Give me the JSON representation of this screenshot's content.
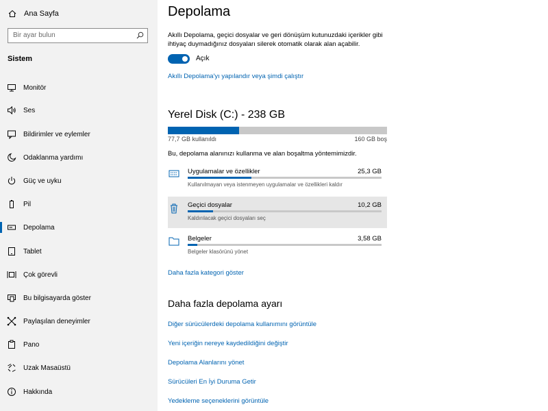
{
  "sidebar": {
    "home_label": "Ana Sayfa",
    "search_placeholder": "Bir ayar bulun",
    "section_label": "Sistem",
    "items": [
      {
        "label": "Monitör",
        "icon": "monitor-icon"
      },
      {
        "label": "Ses",
        "icon": "speaker-icon"
      },
      {
        "label": "Bildirimler ve eylemler",
        "icon": "notifications-icon"
      },
      {
        "label": "Odaklanma yardımı",
        "icon": "moon-icon"
      },
      {
        "label": "Güç ve uyku",
        "icon": "power-icon"
      },
      {
        "label": "Pil",
        "icon": "battery-icon"
      },
      {
        "label": "Depolama",
        "icon": "storage-icon",
        "active": true
      },
      {
        "label": "Tablet",
        "icon": "tablet-icon"
      },
      {
        "label": "Çok görevli",
        "icon": "multitasking-icon"
      },
      {
        "label": "Bu bilgisayarda göster",
        "icon": "project-icon"
      },
      {
        "label": "Paylaşılan deneyimler",
        "icon": "shared-experiences-icon"
      },
      {
        "label": "Pano",
        "icon": "clipboard-icon"
      },
      {
        "label": "Uzak Masaüstü",
        "icon": "remote-desktop-icon"
      },
      {
        "label": "Hakkında",
        "icon": "info-icon"
      }
    ]
  },
  "main": {
    "title": "Depolama",
    "description": "Akıllı Depolama, geçici dosyalar ve geri dönüşüm kutunuzdaki içerikler gibi ihtiyaç duymadığınız dosyaları silerek otomatik olarak alan açabilir.",
    "toggle_state": "Açık",
    "configure_link": "Akıllı Depolama'yı yapılandır veya şimdi çalıştır",
    "disk": {
      "title": "Yerel Disk (C:) - 238 GB",
      "used_label": "77,7 GB kullanıldı",
      "free_label": "160 GB boş",
      "used_fraction": 0.326
    },
    "usage_text": "Bu, depolama alanınızı kullanma ve alan boşaltma yöntemimizdir.",
    "categories": [
      {
        "name": "Uygulamalar ve özellikler",
        "size": "25,3 GB",
        "sub": "Kullanılmayan veya istenmeyen uygulamalar ve özellikleri kaldır",
        "fraction": 0.33,
        "icon": "apps-icon"
      },
      {
        "name": "Geçici dosyalar",
        "size": "10,2 GB",
        "sub": "Kaldırılacak geçici dosyaları seç",
        "fraction": 0.13,
        "icon": "trash-icon"
      },
      {
        "name": "Belgeler",
        "size": "3,58 GB",
        "sub": "Belgeler klasörünü yönet",
        "fraction": 0.05,
        "icon": "documents-icon"
      }
    ],
    "more_categories_link": "Daha fazla kategori göster",
    "more_settings_title": "Daha fazla depolama ayarı",
    "more_links": [
      "Diğer sürücülerdeki depolama kullanımını görüntüle",
      "Yeni içeriğin nereye kaydedildiğini değiştir",
      "Depolama Alanlarını yönet",
      "Sürücüleri En İyi Duruma Getir",
      "Yedekleme seçeneklerini görüntüle"
    ]
  },
  "colors": {
    "accent": "#0063b1",
    "sidebar_bg": "#f2f2f2",
    "bar_bg": "#c8c8c8"
  }
}
